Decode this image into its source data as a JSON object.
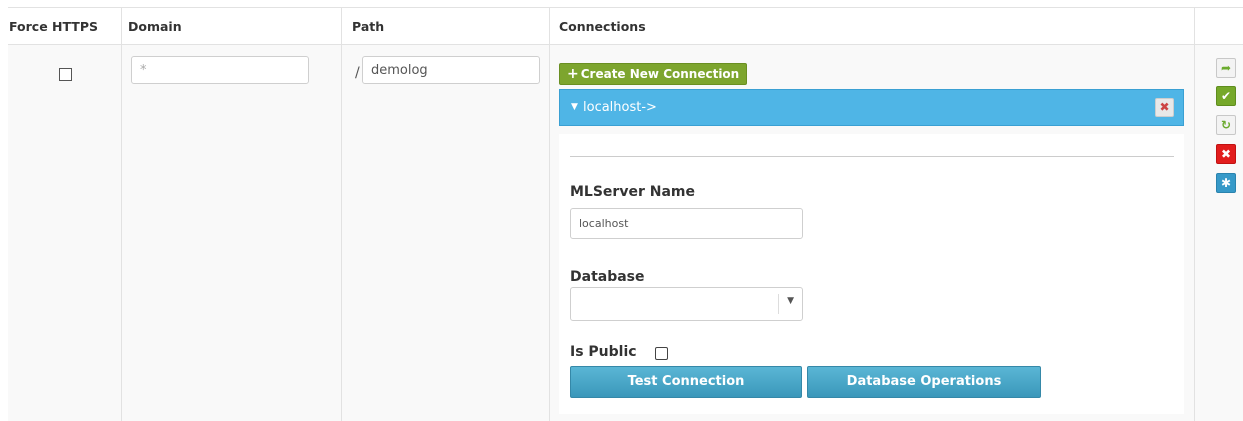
{
  "table": {
    "headers": {
      "force_https": "Force HTTPS",
      "domain": "Domain",
      "path": "Path",
      "connections": "Connections"
    },
    "row": {
      "force_https_checked": false,
      "domain_placeholder": "*",
      "path_prefix": "/",
      "path_value": "demolog"
    }
  },
  "connections": {
    "create_button_label": "Create New Connection",
    "items": [
      {
        "label": "localhost->",
        "expanded": true,
        "mlserver_label": "MLServer Name",
        "mlserver_value": "localhost",
        "database_label": "Database",
        "database_value": "",
        "is_public_label": "Is Public",
        "is_public_checked": false,
        "test_button_label": "Test Connection",
        "db_ops_button_label": "Database Operations"
      }
    ]
  },
  "row_actions": [
    {
      "icon": "export-icon",
      "style": "plain"
    },
    {
      "icon": "check-icon",
      "style": "green"
    },
    {
      "icon": "refresh-icon",
      "style": "plain"
    },
    {
      "icon": "delete-icon",
      "style": "red"
    },
    {
      "icon": "gear-icon",
      "style": "blue"
    }
  ],
  "colors": {
    "create_button": "#7da52e",
    "connection_header": "#4fb5e6",
    "action_button": "#3a97ba",
    "delete_button": "#e21d1d"
  }
}
